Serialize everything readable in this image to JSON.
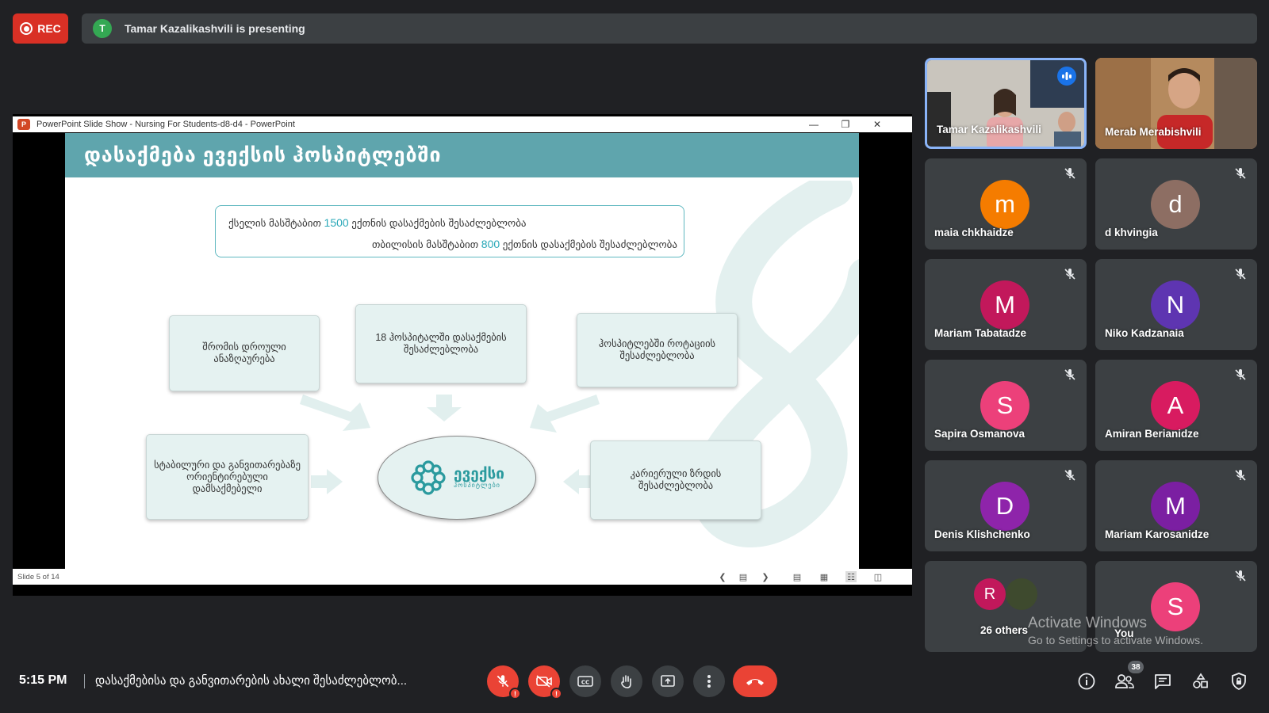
{
  "recording": {
    "label": "REC"
  },
  "presenter_bar": {
    "initial": "T",
    "text": "Tamar Kazalikashvili is presenting"
  },
  "ppt_window": {
    "title": "PowerPoint Slide Show  -  Nursing For  Students-d8-d4  -  PowerPoint",
    "status": "Slide 5 of 14"
  },
  "slide": {
    "title": "დასაქმება ევექსის ჰოსპიტლებში",
    "top_box": {
      "line1_pre": "ქსელის მასშტაბით ",
      "line1_num": "1500",
      "line1_post": " ექთნის დასაქმების შესაძლებლობა",
      "line2_pre": "თბილისის მასშტაბით ",
      "line2_num": "800",
      "line2_post": " ექთნის დასაქმების შესაძლებლობა"
    },
    "nodes": {
      "schedule": "შრომის დროული ანაზღაურება",
      "hospitals": "18 ჰოსპიტალში დასაქმების შესაძლებლობა",
      "rotation": "ჰოსპიტლებში როტაციის შესაძლებლობა",
      "stable": "სტაბილური და განვითარებაზე ორიენტირებული დამსაქმებელი",
      "career": "კარიერული ზრდის შესაძლებლობა"
    },
    "logo": {
      "name": "ევექსი",
      "sub": "ჰოსპიტლები"
    }
  },
  "participants": [
    {
      "name": "Tamar Kazalikashvili",
      "type": "video"
    },
    {
      "name": "Merab Merabishvili",
      "type": "video"
    },
    {
      "name": "maia chkhaidze",
      "initial": "m",
      "color": "#f57c00"
    },
    {
      "name": "d khvingia",
      "initial": "d",
      "color": "#8d6e63"
    },
    {
      "name": "Mariam Tabatadze",
      "initial": "M",
      "color": "#c2185b"
    },
    {
      "name": "Niko Kadzanaia",
      "initial": "N",
      "color": "#5e35b1"
    },
    {
      "name": "Sapira Osmanova",
      "initial": "S",
      "color": "#ec407a"
    },
    {
      "name": "Amiran Berianidze",
      "initial": "A",
      "color": "#d81b60"
    },
    {
      "name": "Denis Klishchenko",
      "initial": "D",
      "color": "#8e24aa"
    },
    {
      "name": "Mariam Karosanidze",
      "initial": "M",
      "color": "#7b1fa2"
    },
    {
      "name": "26 others",
      "initial": "R",
      "color": "#c2185b"
    },
    {
      "name": "You",
      "initial": "S",
      "color": "#ec407a"
    }
  ],
  "watermark": {
    "line1": "Activate Windows",
    "line2": "Go to Settings to activate Windows."
  },
  "bottom_bar": {
    "time": "5:15 PM",
    "meeting_title": "დასაქმებისა და განვითარების ახალი შესაძლებლობ...",
    "people_count": "38"
  },
  "colors": {
    "accent_red": "#ea4335",
    "speaking_blue": "#8ab4f8",
    "slide_teal": "#5fa5ad"
  },
  "icons": [
    "mic-off-icon",
    "camera-off-icon",
    "captions-icon",
    "raise-hand-icon",
    "present-icon",
    "more-options-icon",
    "end-call-icon",
    "info-icon",
    "people-icon",
    "chat-icon",
    "activities-icon",
    "host-controls-icon"
  ]
}
